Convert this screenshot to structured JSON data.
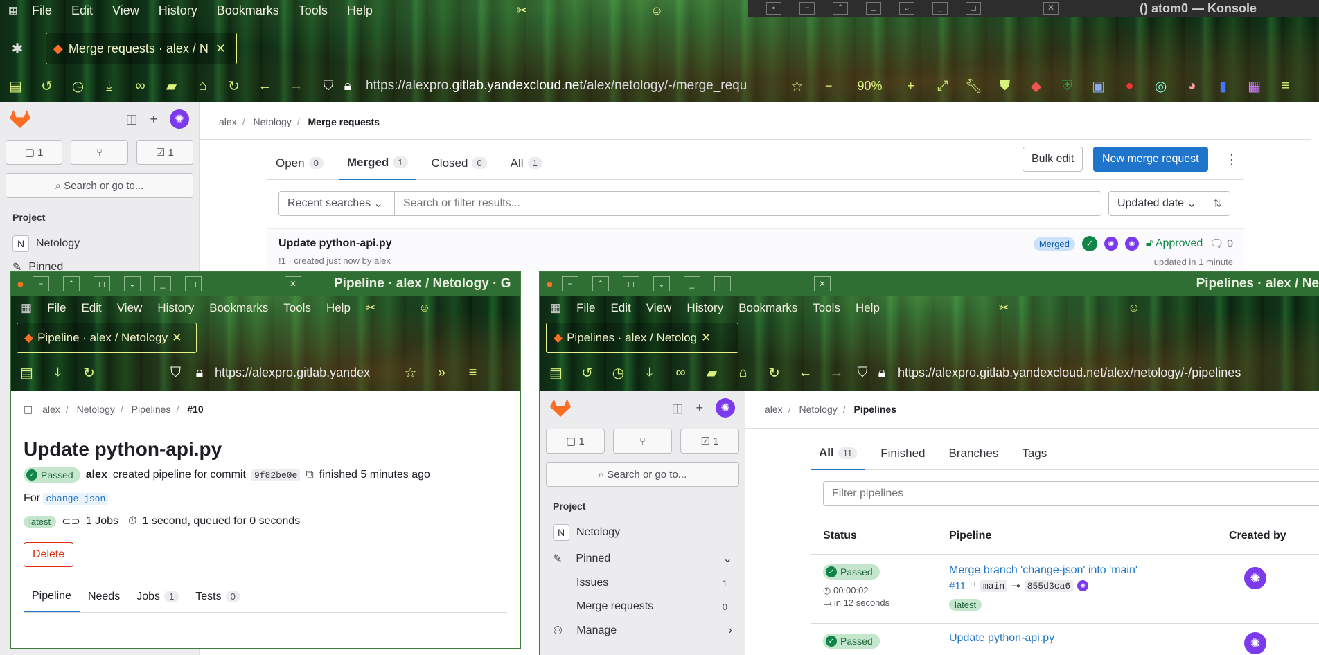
{
  "browser": {
    "menu": [
      "File",
      "Edit",
      "View",
      "History",
      "Bookmarks",
      "Tools",
      "Help"
    ],
    "tab_title": "Merge requests · alex / N",
    "url_prefix": "https://alexpro.",
    "url_domain": "gitlab.yandexcloud.net",
    "url_suffix": "/alex/netology/-/merge_requ",
    "zoom": "90%",
    "zoom_minus": "−",
    "zoom_plus": "+"
  },
  "konsole": {
    "title": "() atom0 — Konsole"
  },
  "sidebar": {
    "issues_count": "1",
    "todo_count": "1",
    "search_placeholder": "Search or go to...",
    "section_label": "Project",
    "project_letter": "N",
    "project_name": "Netology",
    "pinned_label": "Pinned"
  },
  "main": {
    "breadcrumb": [
      "alex",
      "Netology",
      "Merge requests"
    ],
    "tabs": [
      {
        "label": "Open",
        "count": "0"
      },
      {
        "label": "Merged",
        "count": "1"
      },
      {
        "label": "Closed",
        "count": "0"
      },
      {
        "label": "All",
        "count": "1"
      }
    ],
    "bulk_edit": "Bulk edit",
    "new_mr": "New merge request",
    "recent_searches": "Recent searches",
    "filter_placeholder": "Search or filter results...",
    "sort_label": "Updated date",
    "mr": {
      "title": "Update python-api.py",
      "meta": "!1 · created just now by alex",
      "status": "Merged",
      "approved": "Approved",
      "comments": "0",
      "updated": "updated in 1 minute"
    }
  },
  "pipeline_window": {
    "title": "Pipeline · alex / Netology · G",
    "tab_title": "Pipeline · alex / Netology",
    "url": "https://alexpro.gitlab.yandex",
    "breadcrumb": [
      "alex",
      "Netology",
      "Pipelines",
      "#10"
    ],
    "heading": "Update python-api.py",
    "status": "Passed",
    "author": "alex",
    "created_text": "created pipeline for commit",
    "commit": "9f82be0e",
    "finished": "finished 5 minutes ago",
    "for_label": "For",
    "branch": "change-json",
    "latest": "latest",
    "jobs": "1 Jobs",
    "duration": "1 second, queued for 0 seconds",
    "delete": "Delete",
    "tabs": [
      {
        "label": "Pipeline",
        "count": ""
      },
      {
        "label": "Needs",
        "count": ""
      },
      {
        "label": "Jobs",
        "count": "1"
      },
      {
        "label": "Tests",
        "count": "0"
      }
    ]
  },
  "pipelines_window": {
    "title": "Pipelines · alex / Ne",
    "tab_title": "Pipelines · alex / Netolog",
    "url": "https://alexpro.gitlab.yandexcloud.net/alex/netology/-/pipelines",
    "breadcrumb": [
      "alex",
      "Netology",
      "Pipelines"
    ],
    "sidebar": {
      "issues_count": "1",
      "todo_count": "1",
      "search_placeholder": "Search or go to...",
      "section_label": "Project",
      "project_name": "Netology",
      "pinned": "Pinned",
      "issues": "Issues",
      "issues_badge": "1",
      "merge_requests": "Merge requests",
      "mr_badge": "0",
      "manage": "Manage"
    },
    "tabs": [
      {
        "label": "All",
        "count": "11"
      },
      {
        "label": "Finished",
        "count": ""
      },
      {
        "label": "Branches",
        "count": ""
      },
      {
        "label": "Tags",
        "count": ""
      }
    ],
    "filter_placeholder": "Filter pipelines",
    "columns": [
      "Status",
      "Pipeline",
      "Created by"
    ],
    "rows": [
      {
        "status": "Passed",
        "duration": "00:00:02",
        "when": "in 12 seconds",
        "title": "Merge branch 'change-json' into 'main'",
        "id": "#11",
        "branch": "main",
        "commit": "855d3ca6",
        "tag": "latest"
      },
      {
        "status": "Passed",
        "title": "Update python-api.py"
      }
    ]
  }
}
